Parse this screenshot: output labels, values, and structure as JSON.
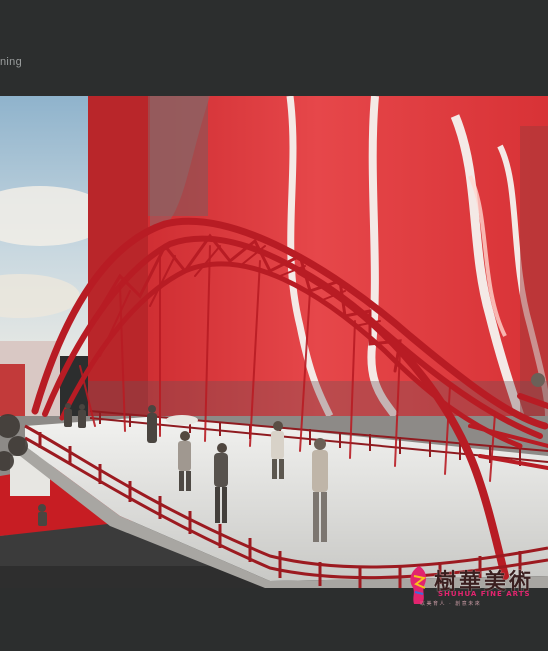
{
  "caption": "ning",
  "watermark": {
    "main_text": "樹華美術",
    "english_text": "SHUHUA FINE ARTS",
    "sub_text": "以美育人 · 創意未來"
  },
  "colors": {
    "page_background": "#2c2e2e",
    "bridge_red": "#b81c24",
    "building_red": "#e23a3c",
    "sky": "#a9c4d6",
    "watermark_pink": "#e2246e"
  }
}
